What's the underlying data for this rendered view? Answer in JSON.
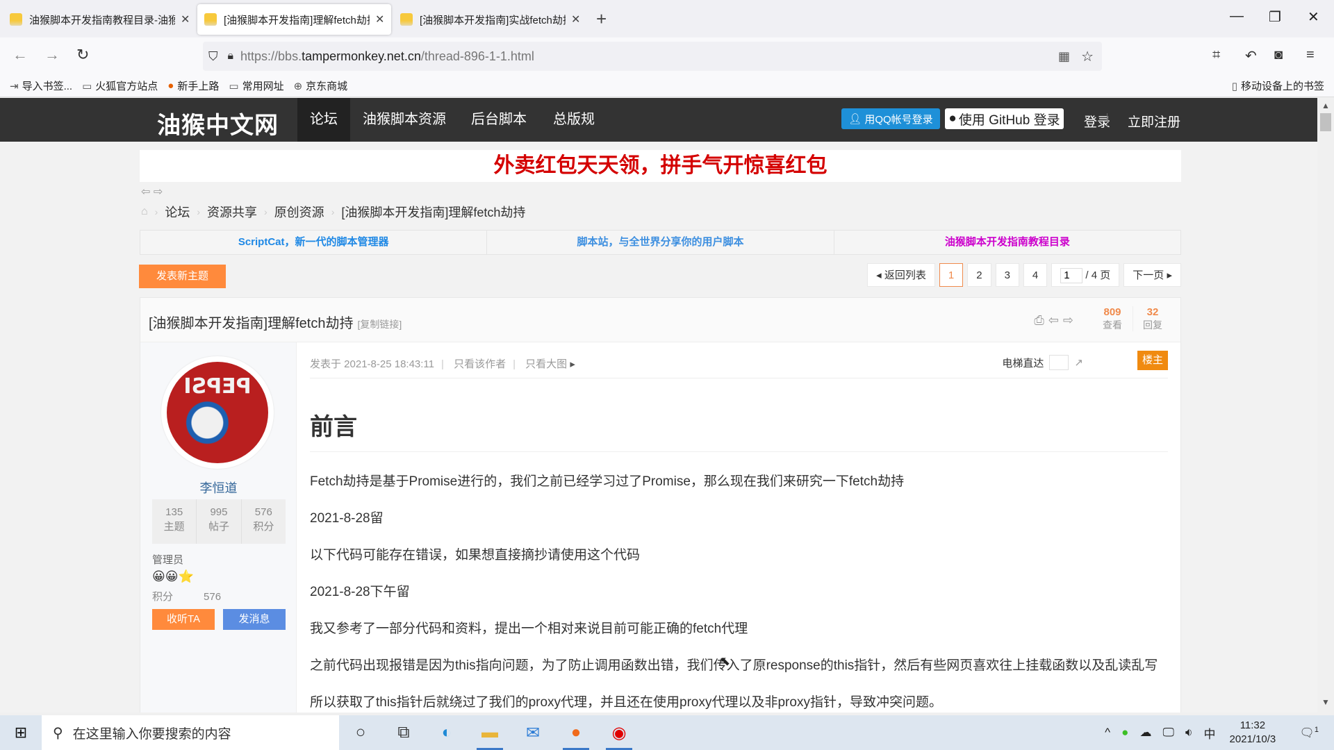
{
  "browser": {
    "tabs": [
      {
        "title": "油猴脚本开发指南教程目录-油猴中文网",
        "active": false
      },
      {
        "title": "[油猴脚本开发指南]理解fetch劫持",
        "active": true
      },
      {
        "title": "[油猴脚本开发指南]实战fetch劫持",
        "active": false
      }
    ],
    "new_tab": "+",
    "window": {
      "minimize": "—",
      "restore": "❐",
      "close": "✕"
    },
    "nav": {
      "back": "←",
      "forward": "→",
      "reload": "↻"
    },
    "url_prefix": "https://bbs.",
    "url_host": "tampermonkey.net.cn",
    "url_path": "/thread-896-1-1.html",
    "bookmarks": [
      {
        "icon": "import-icon",
        "glyph": "⇥",
        "label": "导入书签..."
      },
      {
        "icon": "folder-icon",
        "glyph": "▭",
        "label": "火狐官方站点"
      },
      {
        "icon": "firefox-icon",
        "glyph": "●",
        "label": "新手上路"
      },
      {
        "icon": "folder-icon",
        "glyph": "▭",
        "label": "常用网址"
      },
      {
        "icon": "globe-icon",
        "glyph": "⊕",
        "label": "京东商城"
      }
    ],
    "mobile_bookmarks": "移动设备上的书签"
  },
  "site": {
    "logo": "油猴中文网",
    "nav": [
      "论坛",
      "油猴脚本资源",
      "后台脚本",
      "总版规"
    ],
    "qq_login": "用QQ帐号登录",
    "github_login": "使用 GitHub 登录",
    "login": "登录",
    "register": "立即注册"
  },
  "banner": "外卖红包天天领，拼手气开惊喜红包",
  "breadcrumb": [
    "论坛",
    "资源共享",
    "原创资源",
    "[油猴脚本开发指南]理解fetch劫持"
  ],
  "linkbar": [
    {
      "label": "ScriptCat，新一代的脚本管理器",
      "color": "#1e88e5"
    },
    {
      "label": "脚本站，与全世界分享你的用户脚本",
      "color": "#3d8fe0"
    },
    {
      "label": "油猴脚本开发指南教程目录",
      "color": "#cc00cc"
    }
  ],
  "new_topic": "发表新主题",
  "pager": {
    "back": "返回列表",
    "pages": [
      "1",
      "2",
      "3",
      "4"
    ],
    "current": "1",
    "input_value": "1",
    "total": "/ 4 页",
    "next": "下一页"
  },
  "thread": {
    "title": "[油猴脚本开发指南]理解fetch劫持",
    "copy_link": "[复制链接]",
    "views": "809",
    "views_label": "查看",
    "replies": "32",
    "replies_label": "回复"
  },
  "author": {
    "name": "李恒道",
    "avatar_text": "PEPSI",
    "stats": [
      {
        "value": "135",
        "label": "主题"
      },
      {
        "value": "995",
        "label": "帖子"
      },
      {
        "value": "576",
        "label": "积分"
      }
    ],
    "role": "管理员",
    "badges": "😀😀⭐",
    "points_label": "积分",
    "points": "576",
    "follow": "收听TA",
    "message": "发消息"
  },
  "post": {
    "posted_at": "发表于 2021-8-25 18:43:11",
    "only_author": "只看该作者",
    "only_images": "只看大图",
    "elevator": "电梯直达",
    "floor_badge": "楼主",
    "heading": "前言",
    "paragraphs": [
      "Fetch劫持是基于Promise进行的，我们之前已经学习过了Promise，那么现在我们来研究一下fetch劫持",
      "2021-8-28留",
      "以下代码可能存在错误，如果想直接摘抄请使用这个代码",
      "2021-8-28下午留",
      "我又参考了一部分代码和资料，提出一个相对来说目前可能正确的fetch代理",
      "之前代码出现报错是因为this指向问题，为了防止调用函数出错，我们传入了原response的this指针，然后有些网页喜欢往上挂载函数以及乱读乱写",
      "所以获取了this指针后就绕过了我们的proxy代理，并且还在使用proxy代理以及非proxy指针，导致冲突问题。"
    ]
  },
  "taskbar": {
    "search_placeholder": "在这里输入你要搜索的内容",
    "time": "11:32",
    "date": "2021/10/3",
    "ime": "中",
    "notifications": "1"
  }
}
